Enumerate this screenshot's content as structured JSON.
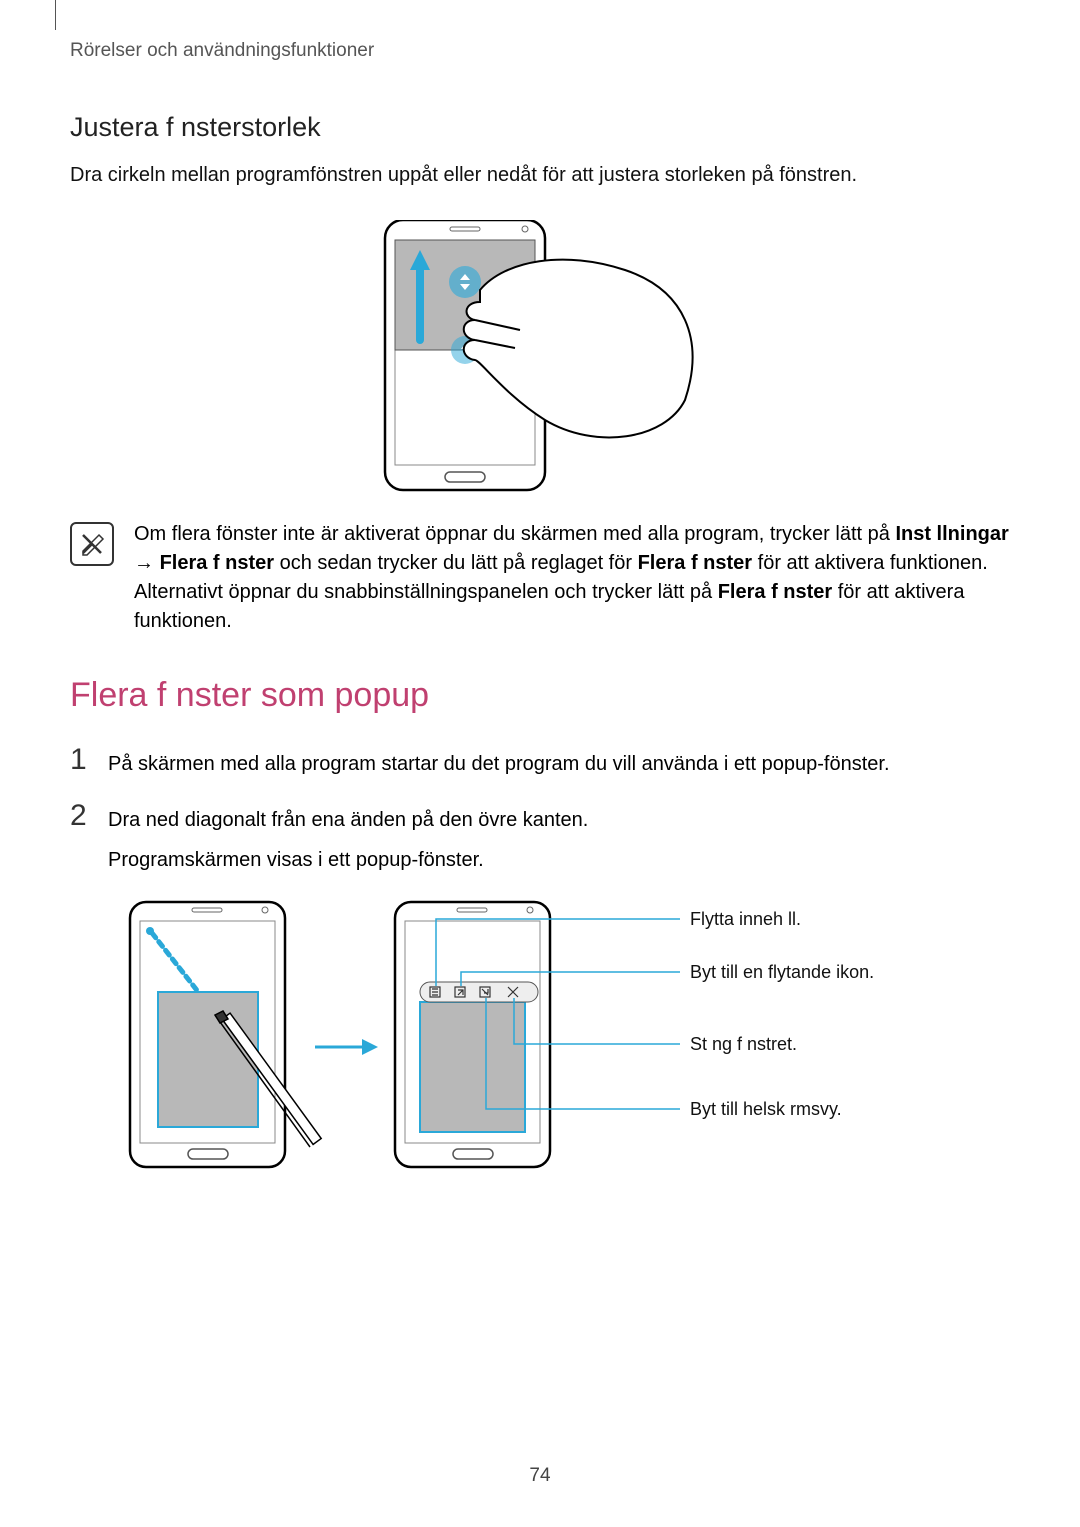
{
  "header": "Rörelser och användningsfunktioner",
  "subheading": "Justera f nsterstorlek",
  "intro": "Dra cirkeln mellan programfönstren uppåt eller nedåt för att justera storleken på fönstren.",
  "note": {
    "p1_a": "Om flera fönster inte är aktiverat öppnar du skärmen med alla program, trycker lätt på ",
    "bold1": "Inst llningar",
    "arrow": " → ",
    "bold2": "Flera f nster",
    "p1_b": " och sedan trycker du lätt på reglaget för ",
    "bold3": "Flera f nster",
    "p1_c": " för att aktivera funktionen. Alternativt öppnar du snabbinställningspanelen och trycker lätt på ",
    "bold4": "Flera f nster",
    "p1_d": " för att aktivera funktionen."
  },
  "section_heading": "Flera f nster som popup",
  "steps": {
    "1": "På skärmen med alla program startar du det program du vill använda i ett popup-fönster.",
    "2a": "Dra ned diagonalt från ena änden på den övre kanten.",
    "2b": "Programskärmen visas i ett popup-fönster."
  },
  "callouts": {
    "move": "Flytta inneh ll.",
    "float": "Byt till en flytande ikon.",
    "close": "St ng f nstret.",
    "full": "Byt till helsk rmsvy."
  },
  "page_num": "74"
}
